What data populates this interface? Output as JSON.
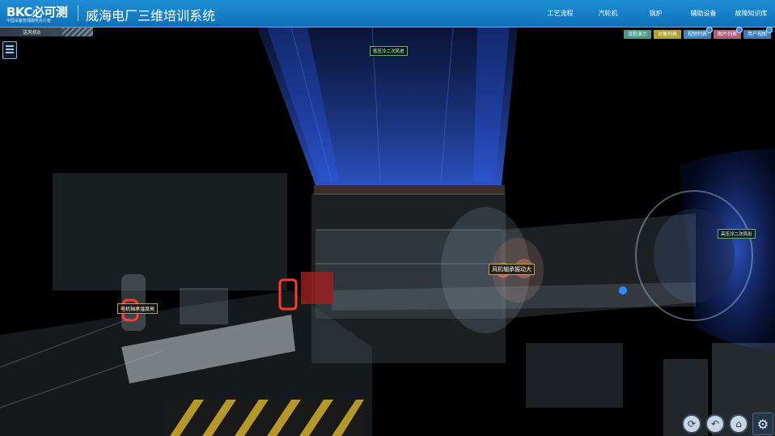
{
  "header": {
    "logo_main": "BKC必可测",
    "logo_sub": "中国设备管理服务先行者",
    "title": "威海电厂三维培训系统",
    "nav": [
      "工艺流程",
      "汽轮机",
      "锅炉",
      "辅助设备",
      "故障知识库"
    ]
  },
  "object_tab": {
    "label": "送风机B"
  },
  "toolbar": [
    {
      "label": "流程演示",
      "color": "#4a9a8c",
      "badge": false
    },
    {
      "label": "对象列表",
      "color": "#b3a232",
      "badge": false
    },
    {
      "label": "视频列表",
      "color": "#3f86c2",
      "badge": true
    },
    {
      "label": "图片列表",
      "color": "#b35f7d",
      "badge": true
    },
    {
      "label": "用户视图",
      "color": "#3a7bbf",
      "badge": true
    }
  ],
  "labels": {
    "inlet": "低压冷二次风进",
    "outlet": "高压冷二次风出",
    "motor_alarm": "电机轴承温度高",
    "fan_alarm": "风机轴承振动大"
  },
  "icons": {
    "menu": "list-icon",
    "refresh": "refresh-icon",
    "back": "undo-icon",
    "home": "home-icon",
    "settings": "gear-icon"
  }
}
